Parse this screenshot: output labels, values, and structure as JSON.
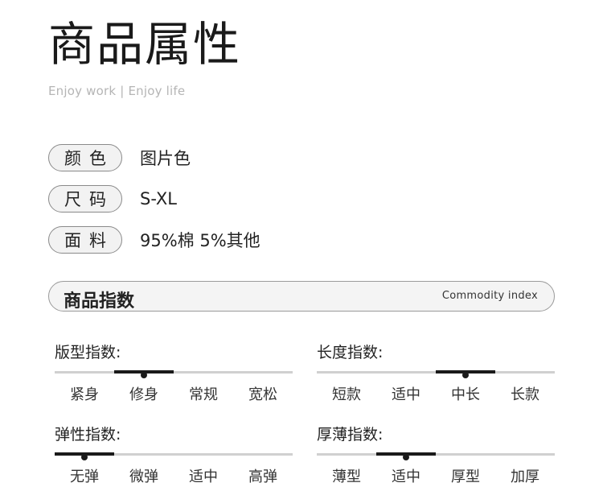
{
  "header": {
    "title": "商品属性",
    "subtitle": "Enjoy work | Enjoy life"
  },
  "attributes": [
    {
      "label": "颜色",
      "value": "图片色"
    },
    {
      "label": "尺码",
      "value": "S-XL"
    },
    {
      "label": "面料",
      "value": "95%棉 5%其他"
    }
  ],
  "index_section": {
    "title": "商品指数",
    "subtitle_en": "Commodity index"
  },
  "metrics": [
    {
      "label": "版型指数:",
      "options": [
        "紧身",
        "修身",
        "常规",
        "宽松"
      ],
      "selected_index": 1
    },
    {
      "label": "长度指数:",
      "options": [
        "短款",
        "适中",
        "中长",
        "长款"
      ],
      "selected_index": 2
    },
    {
      "label": "弹性指数:",
      "options": [
        "无弹",
        "微弹",
        "适中",
        "高弹"
      ],
      "selected_index": 0
    },
    {
      "label": "厚薄指数:",
      "options": [
        "薄型",
        "适中",
        "厚型",
        "加厚"
      ],
      "selected_index": 1
    }
  ],
  "colors": {
    "accent": "#1a1a1a",
    "track": "#d0d0d0",
    "pill_bg": "#f2f2f2"
  }
}
